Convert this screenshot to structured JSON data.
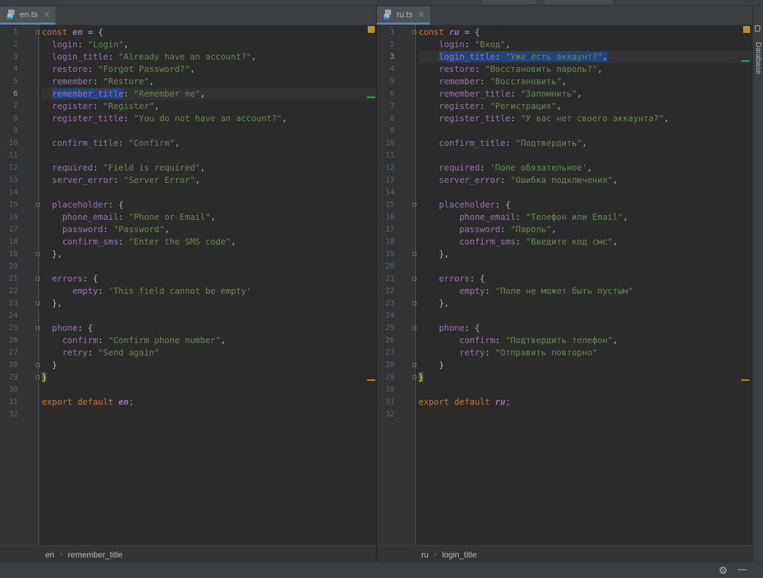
{
  "left": {
    "tab": {
      "icon": "typescript-file-icon",
      "icon_label": "TS",
      "filename": "en.ts",
      "close": "×"
    },
    "current_line": 6,
    "breadcrumb": [
      "en",
      "remember_title"
    ],
    "lines": [
      [
        [
          "kw",
          "const "
        ],
        [
          "var",
          "en"
        ],
        [
          "punc",
          " = {"
        ]
      ],
      [
        [
          "punc",
          "  "
        ],
        [
          "prop",
          "login"
        ],
        [
          "punc",
          ": "
        ],
        [
          "str",
          "\"Login\""
        ],
        [
          "punc",
          ","
        ]
      ],
      [
        [
          "punc",
          "  "
        ],
        [
          "prop",
          "login_title"
        ],
        [
          "punc",
          ": "
        ],
        [
          "str",
          "\"Already have an account?\""
        ],
        [
          "punc",
          ","
        ]
      ],
      [
        [
          "punc",
          "  "
        ],
        [
          "prop",
          "restore"
        ],
        [
          "punc",
          ": "
        ],
        [
          "str",
          "\"Forgot Password?\""
        ],
        [
          "punc",
          ","
        ]
      ],
      [
        [
          "punc",
          "  "
        ],
        [
          "prop",
          "remember"
        ],
        [
          "punc",
          ": "
        ],
        [
          "str",
          "\"Restore\""
        ],
        [
          "punc",
          ","
        ]
      ],
      [
        [
          "punc",
          "  "
        ],
        [
          "prop sel",
          "remember_title"
        ],
        [
          "punc",
          ": "
        ],
        [
          "str",
          "\"Remember me\""
        ],
        [
          "punc",
          ","
        ]
      ],
      [
        [
          "punc",
          "  "
        ],
        [
          "prop",
          "register"
        ],
        [
          "punc",
          ": "
        ],
        [
          "str",
          "\"Register\""
        ],
        [
          "punc",
          ","
        ]
      ],
      [
        [
          "punc",
          "  "
        ],
        [
          "prop",
          "register_title"
        ],
        [
          "punc",
          ": "
        ],
        [
          "str",
          "\"You do not have an account?\""
        ],
        [
          "punc",
          ","
        ]
      ],
      [],
      [
        [
          "punc",
          "  "
        ],
        [
          "prop",
          "confirm_title"
        ],
        [
          "punc",
          ": "
        ],
        [
          "str",
          "\"Confirm\""
        ],
        [
          "punc",
          ","
        ]
      ],
      [],
      [
        [
          "punc",
          "  "
        ],
        [
          "prop",
          "required"
        ],
        [
          "punc",
          ": "
        ],
        [
          "str",
          "\"Field is required\""
        ],
        [
          "punc",
          ","
        ]
      ],
      [
        [
          "punc",
          "  "
        ],
        [
          "prop",
          "server_error"
        ],
        [
          "punc",
          ": "
        ],
        [
          "str",
          "\"Server Error\""
        ],
        [
          "punc",
          ","
        ]
      ],
      [],
      [
        [
          "punc",
          "  "
        ],
        [
          "prop",
          "placeholder"
        ],
        [
          "punc",
          ": {"
        ]
      ],
      [
        [
          "punc",
          "    "
        ],
        [
          "prop",
          "phone_email"
        ],
        [
          "punc",
          ": "
        ],
        [
          "str",
          "\"Phone or Email\""
        ],
        [
          "punc",
          ","
        ]
      ],
      [
        [
          "punc",
          "    "
        ],
        [
          "prop",
          "password"
        ],
        [
          "punc",
          ": "
        ],
        [
          "str",
          "\"Password\""
        ],
        [
          "punc",
          ","
        ]
      ],
      [
        [
          "punc",
          "    "
        ],
        [
          "prop",
          "confirm_sms"
        ],
        [
          "punc",
          ": "
        ],
        [
          "str",
          "\"Enter the SMS code\""
        ],
        [
          "punc",
          ","
        ]
      ],
      [
        [
          "punc",
          "  },"
        ]
      ],
      [],
      [
        [
          "punc",
          "  "
        ],
        [
          "prop",
          "errors"
        ],
        [
          "punc",
          ": {"
        ]
      ],
      [
        [
          "punc",
          "      "
        ],
        [
          "prop",
          "empty"
        ],
        [
          "punc",
          ": "
        ],
        [
          "str",
          "'This field cannot be empty'"
        ]
      ],
      [
        [
          "punc",
          "  },"
        ]
      ],
      [],
      [
        [
          "punc",
          "  "
        ],
        [
          "prop",
          "phone"
        ],
        [
          "punc",
          ": {"
        ]
      ],
      [
        [
          "punc",
          "    "
        ],
        [
          "prop",
          "confirm"
        ],
        [
          "punc",
          ": "
        ],
        [
          "str",
          "\"Confirm phone number\""
        ],
        [
          "punc",
          ","
        ]
      ],
      [
        [
          "punc",
          "    "
        ],
        [
          "prop",
          "retry"
        ],
        [
          "punc",
          ": "
        ],
        [
          "str",
          "\"Send again\""
        ]
      ],
      [
        [
          "punc",
          "  }"
        ]
      ],
      [
        [
          "brace-hl",
          "}"
        ]
      ],
      [],
      [
        [
          "kw",
          "export default "
        ],
        [
          "var",
          "en"
        ],
        [
          "kw",
          ";"
        ]
      ],
      []
    ]
  },
  "right": {
    "tab": {
      "icon": "typescript-file-icon",
      "icon_label": "TS",
      "filename": "ru.ts",
      "close": "×"
    },
    "current_line": 3,
    "breadcrumb": [
      "ru",
      "login_title"
    ],
    "lines": [
      [
        [
          "kw",
          "const "
        ],
        [
          "var",
          "ru"
        ],
        [
          "punc",
          " = {"
        ]
      ],
      [
        [
          "punc",
          "    "
        ],
        [
          "prop",
          "login"
        ],
        [
          "punc",
          ": "
        ],
        [
          "str",
          "\"Вход\""
        ],
        [
          "punc",
          ","
        ]
      ],
      [
        [
          "punc",
          "    "
        ],
        [
          "prop sel",
          "login_title"
        ],
        [
          "punc sel",
          ": "
        ],
        [
          "str sel",
          "\"Уже есть аккаунт?\""
        ],
        [
          "punc sel",
          ","
        ]
      ],
      [
        [
          "punc",
          "    "
        ],
        [
          "prop",
          "restore"
        ],
        [
          "punc",
          ": "
        ],
        [
          "str",
          "\"Восстановить пароль?\""
        ],
        [
          "punc",
          ","
        ]
      ],
      [
        [
          "punc",
          "    "
        ],
        [
          "prop",
          "remember"
        ],
        [
          "punc",
          ": "
        ],
        [
          "str",
          "\"Восстановить\""
        ],
        [
          "punc",
          ","
        ]
      ],
      [
        [
          "punc",
          "    "
        ],
        [
          "prop",
          "remember_title"
        ],
        [
          "punc",
          ": "
        ],
        [
          "str",
          "\"Запомнить\""
        ],
        [
          "punc",
          ","
        ]
      ],
      [
        [
          "punc",
          "    "
        ],
        [
          "prop",
          "register"
        ],
        [
          "punc",
          ": "
        ],
        [
          "str",
          "\"Регистрация\""
        ],
        [
          "punc",
          ","
        ]
      ],
      [
        [
          "punc",
          "    "
        ],
        [
          "prop",
          "register_title"
        ],
        [
          "punc",
          ": "
        ],
        [
          "str",
          "\"У вас нет своего аккаунта?\""
        ],
        [
          "punc",
          ","
        ]
      ],
      [],
      [
        [
          "punc",
          "    "
        ],
        [
          "prop",
          "confirm_title"
        ],
        [
          "punc",
          ": "
        ],
        [
          "str",
          "\"Подтвердить\""
        ],
        [
          "punc",
          ","
        ]
      ],
      [],
      [
        [
          "punc",
          "    "
        ],
        [
          "prop",
          "required"
        ],
        [
          "punc",
          ": "
        ],
        [
          "str",
          "'Поле обязательное'"
        ],
        [
          "punc",
          ","
        ]
      ],
      [
        [
          "punc",
          "    "
        ],
        [
          "prop",
          "server_error"
        ],
        [
          "punc",
          ": "
        ],
        [
          "str",
          "\"Ошибка подключения\""
        ],
        [
          "punc",
          ","
        ]
      ],
      [],
      [
        [
          "punc",
          "    "
        ],
        [
          "prop",
          "placeholder"
        ],
        [
          "punc",
          ": {"
        ]
      ],
      [
        [
          "punc",
          "        "
        ],
        [
          "prop",
          "phone_email"
        ],
        [
          "punc",
          ": "
        ],
        [
          "str",
          "\"Телефон или Email\""
        ],
        [
          "punc",
          ","
        ]
      ],
      [
        [
          "punc",
          "        "
        ],
        [
          "prop",
          "password"
        ],
        [
          "punc",
          ": "
        ],
        [
          "str",
          "\"Пароль\""
        ],
        [
          "punc",
          ","
        ]
      ],
      [
        [
          "punc",
          "        "
        ],
        [
          "prop",
          "confirm_sms"
        ],
        [
          "punc",
          ": "
        ],
        [
          "str",
          "\"Введите код смс\""
        ],
        [
          "punc",
          ","
        ]
      ],
      [
        [
          "punc",
          "    },"
        ]
      ],
      [],
      [
        [
          "punc",
          "    "
        ],
        [
          "prop",
          "errors"
        ],
        [
          "punc",
          ": {"
        ]
      ],
      [
        [
          "punc",
          "        "
        ],
        [
          "prop",
          "empty"
        ],
        [
          "punc",
          ": "
        ],
        [
          "str",
          "\"Поле не может быть пустым\""
        ]
      ],
      [
        [
          "punc",
          "    },"
        ]
      ],
      [],
      [
        [
          "punc",
          "    "
        ],
        [
          "prop",
          "phone"
        ],
        [
          "punc",
          ": {"
        ]
      ],
      [
        [
          "punc",
          "        "
        ],
        [
          "prop",
          "confirm"
        ],
        [
          "punc",
          ": "
        ],
        [
          "str",
          "\"Подтвердить телефон\""
        ],
        [
          "punc",
          ","
        ]
      ],
      [
        [
          "punc",
          "        "
        ],
        [
          "prop",
          "retry"
        ],
        [
          "punc",
          ": "
        ],
        [
          "str",
          "\"Отправить повторно\""
        ]
      ],
      [
        [
          "punc",
          "    }"
        ]
      ],
      [
        [
          "brace-hl",
          "}"
        ]
      ],
      [],
      [
        [
          "kw",
          "export default "
        ],
        [
          "var",
          "ru"
        ],
        [
          "kw",
          ";"
        ]
      ],
      []
    ]
  },
  "right_toolbar": {
    "label": "Database",
    "icon": "database-icon"
  },
  "status_bar": {
    "gear_icon": "gear-icon",
    "gear_glyph": "⚙",
    "minimize_icon": "minimize-icon",
    "minimize_glyph": "—"
  },
  "colors": {
    "keyword": "#cc7832",
    "property": "#9876aa",
    "string": "#6a8759",
    "selection": "#214283",
    "background": "#2b2b2b"
  }
}
